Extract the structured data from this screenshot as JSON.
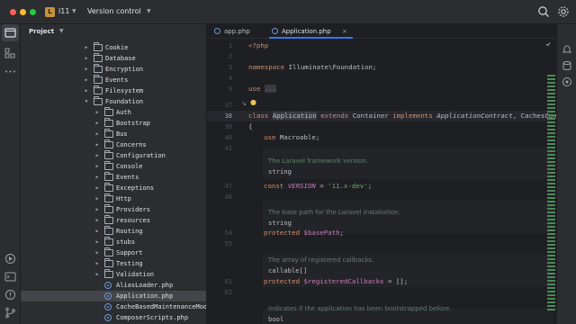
{
  "window": {
    "project_badge": "L",
    "project_name": "l11",
    "vcs_label": "Version control"
  },
  "project_panel": {
    "title": "Project",
    "tree": [
      {
        "label": "Cookie",
        "type": "folder",
        "depth": 2,
        "expanded": false
      },
      {
        "label": "Database",
        "type": "folder",
        "depth": 2,
        "expanded": false
      },
      {
        "label": "Encryption",
        "type": "folder",
        "depth": 2,
        "expanded": false
      },
      {
        "label": "Events",
        "type": "folder",
        "depth": 2,
        "expanded": false
      },
      {
        "label": "Filesystem",
        "type": "folder",
        "depth": 2,
        "expanded": false
      },
      {
        "label": "Foundation",
        "type": "folder",
        "depth": 2,
        "expanded": true
      },
      {
        "label": "Auth",
        "type": "folder",
        "depth": 3,
        "expanded": false
      },
      {
        "label": "Bootstrap",
        "type": "folder",
        "depth": 3,
        "expanded": false
      },
      {
        "label": "Bus",
        "type": "folder",
        "depth": 3,
        "expanded": false
      },
      {
        "label": "Concerns",
        "type": "folder",
        "depth": 3,
        "expanded": false
      },
      {
        "label": "Configuration",
        "type": "folder",
        "depth": 3,
        "expanded": false
      },
      {
        "label": "Console",
        "type": "folder",
        "depth": 3,
        "expanded": false
      },
      {
        "label": "Events",
        "type": "folder",
        "depth": 3,
        "expanded": false
      },
      {
        "label": "Exceptions",
        "type": "folder",
        "depth": 3,
        "expanded": false
      },
      {
        "label": "Http",
        "type": "folder",
        "depth": 3,
        "expanded": false
      },
      {
        "label": "Providers",
        "type": "folder",
        "depth": 3,
        "expanded": false
      },
      {
        "label": "resources",
        "type": "folder",
        "depth": 3,
        "expanded": false
      },
      {
        "label": "Routing",
        "type": "folder",
        "depth": 3,
        "expanded": false
      },
      {
        "label": "stubs",
        "type": "folder",
        "depth": 3,
        "expanded": false
      },
      {
        "label": "Support",
        "type": "folder",
        "depth": 3,
        "expanded": false
      },
      {
        "label": "Testing",
        "type": "folder",
        "depth": 3,
        "expanded": false
      },
      {
        "label": "Validation",
        "type": "folder",
        "depth": 3,
        "expanded": false
      },
      {
        "label": "AliasLoader.php",
        "type": "php",
        "depth": 3
      },
      {
        "label": "Application.php",
        "type": "php",
        "depth": 3,
        "selected": true
      },
      {
        "label": "CacheBasedMaintenanceMode.",
        "type": "php",
        "depth": 3
      },
      {
        "label": "ComposerScripts.php",
        "type": "php",
        "depth": 3
      }
    ]
  },
  "editor": {
    "tabs": [
      {
        "label": "app.php",
        "active": false
      },
      {
        "label": "Application.php",
        "active": true,
        "close": "×"
      }
    ],
    "gutter": [
      "1",
      "2",
      "3",
      "4",
      "9",
      "37",
      "38",
      "39",
      "40",
      "41",
      "",
      "",
      "47",
      "48",
      "",
      "",
      "54",
      "55",
      "",
      "",
      "61",
      "62",
      ""
    ],
    "code": {
      "php_open": "<?php",
      "ns_kw": "namespace",
      "ns_name": " Illuminate\\Foundation;",
      "use_kw": "use",
      "use_fold": "...",
      "class_kw": "class",
      "class_name": "Application",
      "extends_kw": " extends",
      "extends_name": " Container",
      "implements_kw": " implements",
      "implements_name": " ApplicationContract",
      "implements_rest": ", CachesCon",
      "open_brace": "{",
      "use2_kw": "use",
      "use2_rest": " Macroable;",
      "doc1": "The Laravel framework version.",
      "doc1_type": "string",
      "const_kw": "const",
      "const_name": "VERSION",
      "const_eq": " = ",
      "const_val": "'11.x-dev'",
      "const_end": ";",
      "doc2": "The base path for the Laravel installation.",
      "doc2_type": "string",
      "prot1_kw": "protected",
      "prot1_var": "$basePath",
      "prot1_end": ";",
      "doc3": "The array of registered callbacks.",
      "doc3_type": "callable[]",
      "prot2_kw": "protected",
      "prot2_var": "$registeredCallbacks",
      "prot2_rest": " = [];",
      "doc4": "Indicates if the application has been bootstrapped before.",
      "doc4_type": "bool"
    }
  },
  "colors": {
    "accent": "#3574f0",
    "keyword": "#cf8e6d",
    "string": "#6aab73",
    "variable": "#c77dbb",
    "doc_comment": "#5f826b"
  }
}
